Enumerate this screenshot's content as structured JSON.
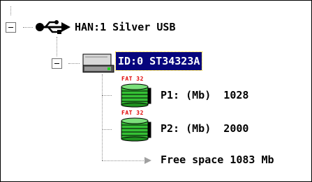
{
  "tree": {
    "host": {
      "label": "HAN:1 Silver USB",
      "icon": "usb-icon",
      "expanded": true
    },
    "device": {
      "label": "ID:0 ST34323A",
      "icon": "hard-drive-icon",
      "expanded": true,
      "selected": true
    },
    "partitions": [
      {
        "fs": "FAT 32",
        "label": "P1: (Mb)  1028",
        "icon": "disk-stack-icon"
      },
      {
        "fs": "FAT 32",
        "label": "P2: (Mb)  2000",
        "icon": "disk-stack-icon"
      }
    ],
    "free_space": {
      "label": "Free space 1083 Mb",
      "icon": "arrow-right-icon"
    }
  },
  "colors": {
    "selection_bg": "#06057d",
    "disk_green": "#35c135",
    "fs_red": "#e00000"
  }
}
